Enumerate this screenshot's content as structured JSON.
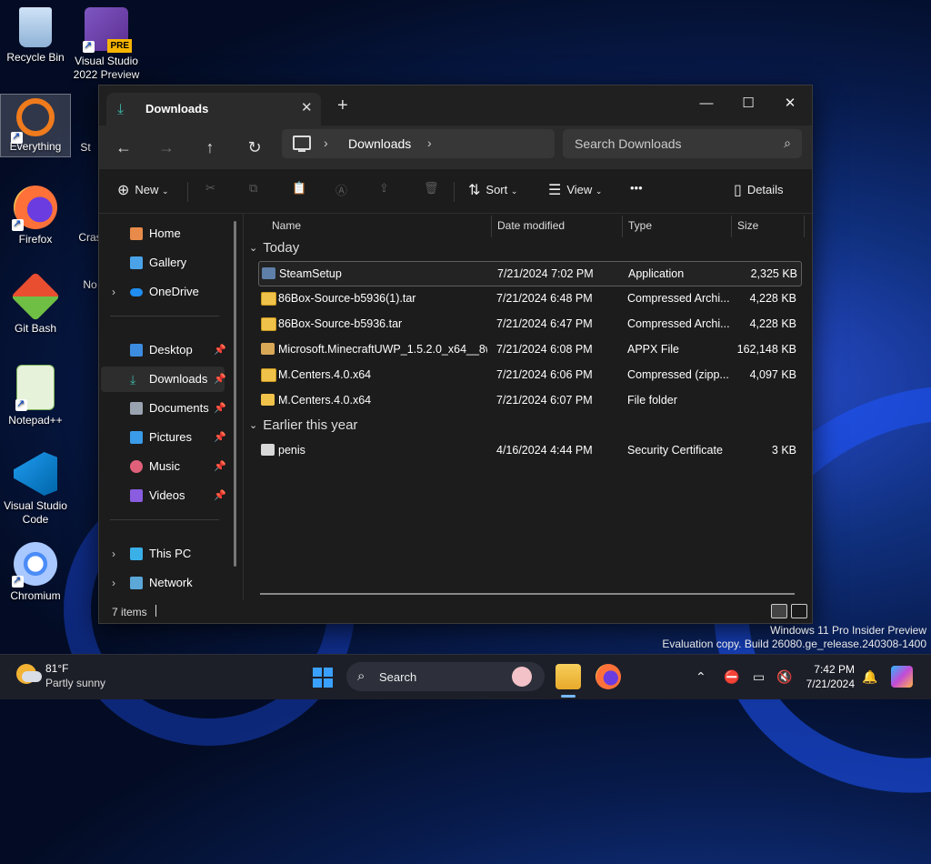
{
  "desktop": {
    "icons": [
      {
        "label": "Recycle Bin"
      },
      {
        "label": "Visual Studio 2022 Preview"
      },
      {
        "label": "Everything"
      },
      {
        "label": "St"
      },
      {
        "label": "Firefox"
      },
      {
        "label": "Cras"
      },
      {
        "label": "Git Bash"
      },
      {
        "label": "No"
      },
      {
        "label": "Notepad++"
      },
      {
        "label": "Visual Studio Code"
      },
      {
        "label": "Chromium"
      }
    ],
    "vs_badge": "PRE"
  },
  "window": {
    "tab_title": "Downloads",
    "tab_close": "✕",
    "new_tab": "+",
    "controls": {
      "minimize": "—",
      "maximize": "☐",
      "close": "✕"
    },
    "nav": {
      "back": "←",
      "forward": "→",
      "up": "↑",
      "refresh": "↻"
    },
    "breadcrumb": "Downloads",
    "search_placeholder": "Search Downloads",
    "toolbar": {
      "new": "New",
      "sort": "Sort",
      "view": "View",
      "more": "•••",
      "details": "Details"
    },
    "sidebar": {
      "home": "Home",
      "gallery": "Gallery",
      "onedrive": "OneDrive",
      "desktop": "Desktop",
      "downloads": "Downloads",
      "documents": "Documents",
      "pictures": "Pictures",
      "music": "Music",
      "videos": "Videos",
      "this_pc": "This PC",
      "network": "Network"
    },
    "columns": {
      "name": "Name",
      "date": "Date modified",
      "type": "Type",
      "size": "Size"
    },
    "groups": {
      "today": "Today",
      "earlier": "Earlier this year"
    },
    "files": [
      {
        "name": "SteamSetup",
        "date": "7/21/2024 7:02 PM",
        "type": "Application",
        "size": "2,325 KB"
      },
      {
        "name": "86Box-Source-b5936(1).tar",
        "date": "7/21/2024 6:48 PM",
        "type": "Compressed Archi...",
        "size": "4,228 KB"
      },
      {
        "name": "86Box-Source-b5936.tar",
        "date": "7/21/2024 6:47 PM",
        "type": "Compressed Archi...",
        "size": "4,228 KB"
      },
      {
        "name": "Microsoft.MinecraftUWP_1.5.2.0_x64__8w...",
        "date": "7/21/2024 6:08 PM",
        "type": "APPX File",
        "size": "162,148 KB"
      },
      {
        "name": "M.Centers.4.0.x64",
        "date": "7/21/2024 6:06 PM",
        "type": "Compressed (zipp...",
        "size": "4,097 KB"
      },
      {
        "name": "M.Centers.4.0.x64",
        "date": "7/21/2024 6:07 PM",
        "type": "File folder",
        "size": ""
      }
    ],
    "earlier_files": [
      {
        "name": "penis",
        "date": "4/16/2024 4:44 PM",
        "type": "Security Certificate",
        "size": "3 KB"
      }
    ],
    "status": "7 items"
  },
  "watermark": {
    "line1": "Windows 11 Pro Insider Preview",
    "line2": "Evaluation copy. Build 26080.ge_release.240308-1400"
  },
  "taskbar": {
    "temp": "81°F",
    "condition": "Partly sunny",
    "search": "Search",
    "time": "7:42 PM",
    "date": "7/21/2024"
  },
  "colors": {
    "accent": "#3aa0ff",
    "folder": "#f0c24a",
    "download_icon": "#3bb6a5"
  }
}
